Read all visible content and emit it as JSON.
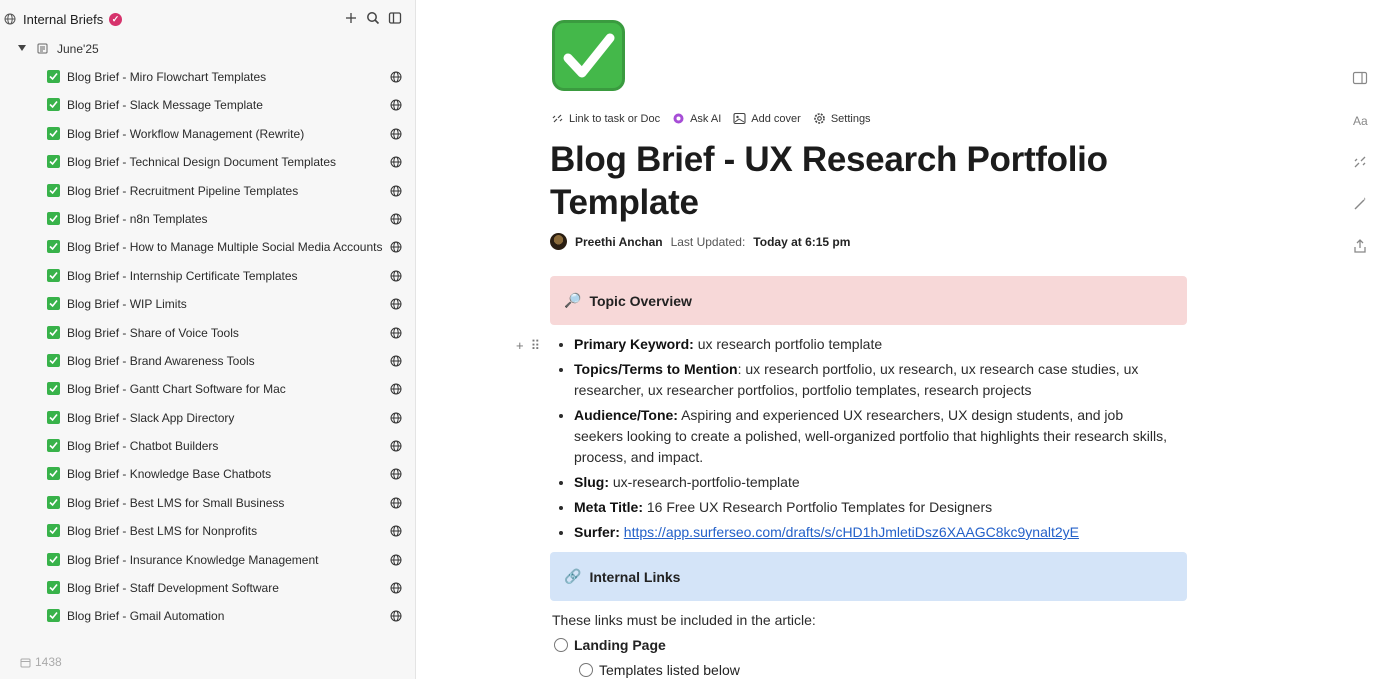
{
  "sidebar": {
    "title": "Internal Briefs",
    "folder": "June'25",
    "items": [
      "Blog Brief - Miro Flowchart Templates",
      "Blog Brief - Slack Message Template",
      "Blog Brief - Workflow Management (Rewrite)",
      "Blog Brief - Technical Design Document Templates",
      "Blog Brief - Recruitment Pipeline Templates",
      "Blog Brief - n8n Templates",
      "Blog Brief - How to Manage Multiple Social Media Accounts",
      "Blog Brief - Internship Certificate Templates",
      "Blog Brief - WIP Limits",
      "Blog Brief - Share of Voice Tools",
      "Blog Brief - Brand Awareness Tools",
      "Blog Brief - Gantt Chart Software for Mac",
      "Blog Brief - Slack App Directory",
      "Blog Brief - Chatbot Builders",
      "Blog Brief - Knowledge Base Chatbots",
      "Blog Brief - Best LMS for Small Business",
      "Blog Brief - Best LMS for Nonprofits",
      "Blog Brief - Insurance Knowledge Management",
      "Blog Brief - Staff Development Software",
      "Blog Brief - Gmail Automation"
    ],
    "footer_count": "1438"
  },
  "toolbar": {
    "link_task": "Link to task or Doc",
    "ask_ai": "Ask AI",
    "add_cover": "Add cover",
    "settings": "Settings"
  },
  "doc": {
    "title": "Blog Brief - UX Research Portfolio Template",
    "author": "Preethi Anchan",
    "updated_label": "Last Updated:",
    "updated_value": "Today at 6:15 pm",
    "topic_heading": "Topic Overview",
    "topic_emoji": "🔎",
    "bullets": {
      "keyword_label": "Primary Keyword:",
      "keyword_value": " ux research portfolio template",
      "terms_label": "Topics/Terms to Mention",
      "terms_value": ": ux research portfolio, ux research, ux research case studies, ux researcher, ux researcher portfolios, portfolio templates, research projects",
      "audience_label": "Audience/Tone:",
      "audience_value": " Aspiring and experienced UX researchers, UX design students, and job seekers looking to create a polished, well-organized portfolio that highlights their research skills, process, and impact.",
      "slug_label": "Slug:",
      "slug_value": " ux-research-portfolio-template",
      "meta_label": "Meta Title:",
      "meta_value": " 16 Free UX Research Portfolio Templates for Designers",
      "surfer_label": "Surfer:",
      "surfer_url": "https://app.surferseo.com/drafts/s/cHD1hJmletiDsz6XAAGC8kc9ynalt2yE"
    },
    "links_heading": "Internal Links",
    "links_emoji": "🔗",
    "links_intro": "These links must be included in the article:",
    "landing_page": "Landing Page",
    "templates_listed": "Templates listed below"
  },
  "colors": {
    "check_green": "#38b24a",
    "callout_red": "#f7d8d8",
    "callout_blue": "#d4e4f8",
    "link_blue": "#2461c9",
    "verified_pink": "#d6336c"
  }
}
